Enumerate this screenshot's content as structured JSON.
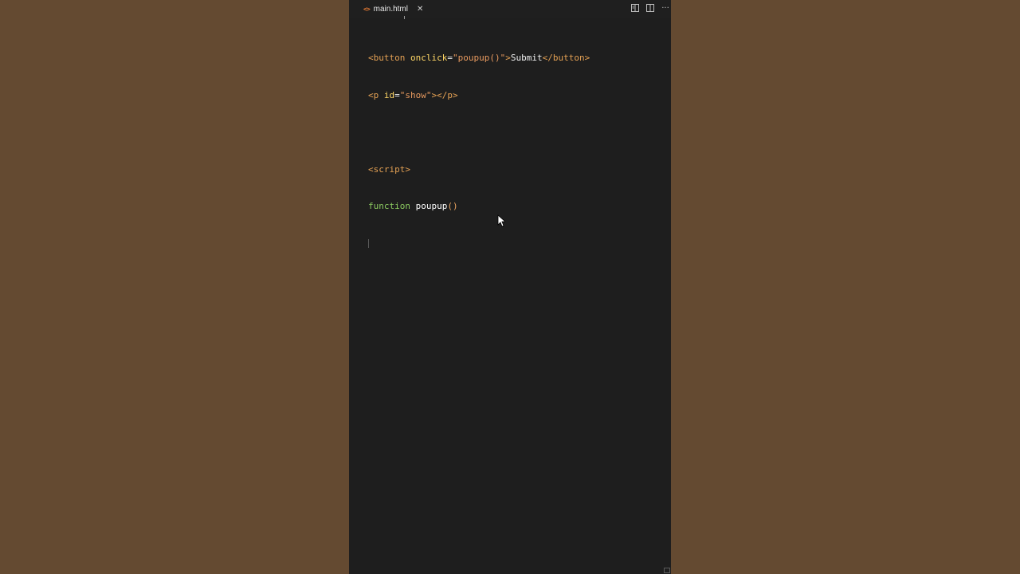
{
  "tab": {
    "file_icon": "<>",
    "filename": "main.html",
    "close_glyph": "✕"
  },
  "actions": {
    "icons": [
      "open-preview-icon",
      "split-editor-icon",
      "more-actions-icon"
    ],
    "more_glyph": "···"
  },
  "code": {
    "line1": {
      "open_lt": "<",
      "tag": "button",
      "attr": "onclick",
      "eq": "=",
      "value": "\"poupup()\"",
      "close_gt": ">",
      "text": "Submit",
      "end_open": "</",
      "end_tag": "button",
      "end_gt": ">"
    },
    "line2": {
      "open_lt": "<",
      "tag": "p",
      "attr": "id",
      "eq": "=",
      "value": "\"show\"",
      "close_gt": ">",
      "end_open": "</",
      "end_tag": "p",
      "end_gt": ">"
    },
    "line4": {
      "open_lt": "<",
      "tag": "script",
      "close_gt": ">"
    },
    "line5": {
      "keyword": "function",
      "name": "poupup",
      "parens": "()"
    }
  },
  "colors": {
    "background": "#644a31",
    "editor": "#1e1e1e",
    "tag": "#e4a154",
    "attribute": "#ffd766",
    "string": "#e89a5f",
    "keyword": "#8bc960"
  }
}
